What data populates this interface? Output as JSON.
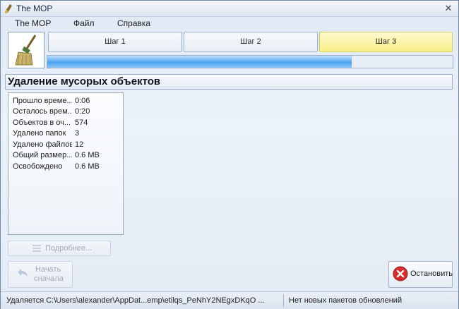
{
  "window": {
    "title": "The MOP",
    "close_symbol": "✕"
  },
  "menu": [
    {
      "label": "The MOP"
    },
    {
      "label": "Файл"
    },
    {
      "label": "Справка"
    }
  ],
  "steps": [
    {
      "label": "Шаг 1",
      "active": false
    },
    {
      "label": "Шаг 2",
      "active": false
    },
    {
      "label": "Шаг 3",
      "active": true
    }
  ],
  "progress": {
    "fraction": 0.75
  },
  "section": {
    "title": "Удаление мусорых объектов"
  },
  "stats": [
    {
      "label": "Прошло време...",
      "value": "0:06"
    },
    {
      "label": "Осталось врем...",
      "value": "0:20"
    },
    {
      "label": "Объектов в оч...",
      "value": "574"
    },
    {
      "label": "Удалено папок",
      "value": "3"
    },
    {
      "label": "Удалено файлов",
      "value": "12"
    },
    {
      "label": "Общий размер...",
      "value": "0.6 MB"
    },
    {
      "label": "Освобождено",
      "value": "0.6 MB"
    }
  ],
  "buttons": {
    "details": "Подробнее...",
    "restart_line1": "Начать",
    "restart_line2": "сначала",
    "stop": "Остановить"
  },
  "status": {
    "left": "Удаляется C:\\Users\\alexander\\AppDat...emp\\etilqs_PeNhY2NEgxDKqO ...",
    "right": "Нет новых пакетов обновлений"
  },
  "colors": {
    "accent_step": "#f6ee87",
    "progress": "#4aa2ee",
    "stop_icon": "#d92b2b"
  }
}
